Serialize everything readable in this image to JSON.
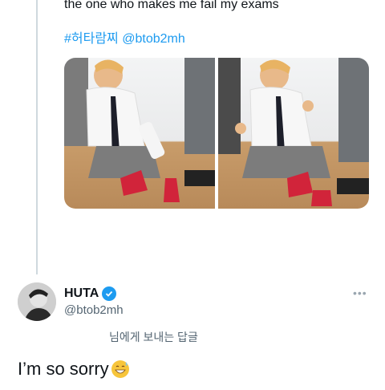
{
  "parent_tweet": {
    "text": "the one who makes me fail my exams",
    "hashtag": "#허타람찌",
    "mention": "@btob2mh",
    "media_alt": [
      "photo-1",
      "photo-2"
    ]
  },
  "reply": {
    "display_name": "HUTA",
    "handle": "@btob2mh",
    "more_glyph": "•••",
    "translation_line": "님에게 보내는 답글",
    "text": "I’m so sorry",
    "emoji_name": "grinning-sweat-emoji"
  },
  "colors": {
    "link": "#1d9bf0",
    "verified": "#1d9bf0",
    "secondary_text": "#536471",
    "thread_line": "#cfd9de"
  }
}
